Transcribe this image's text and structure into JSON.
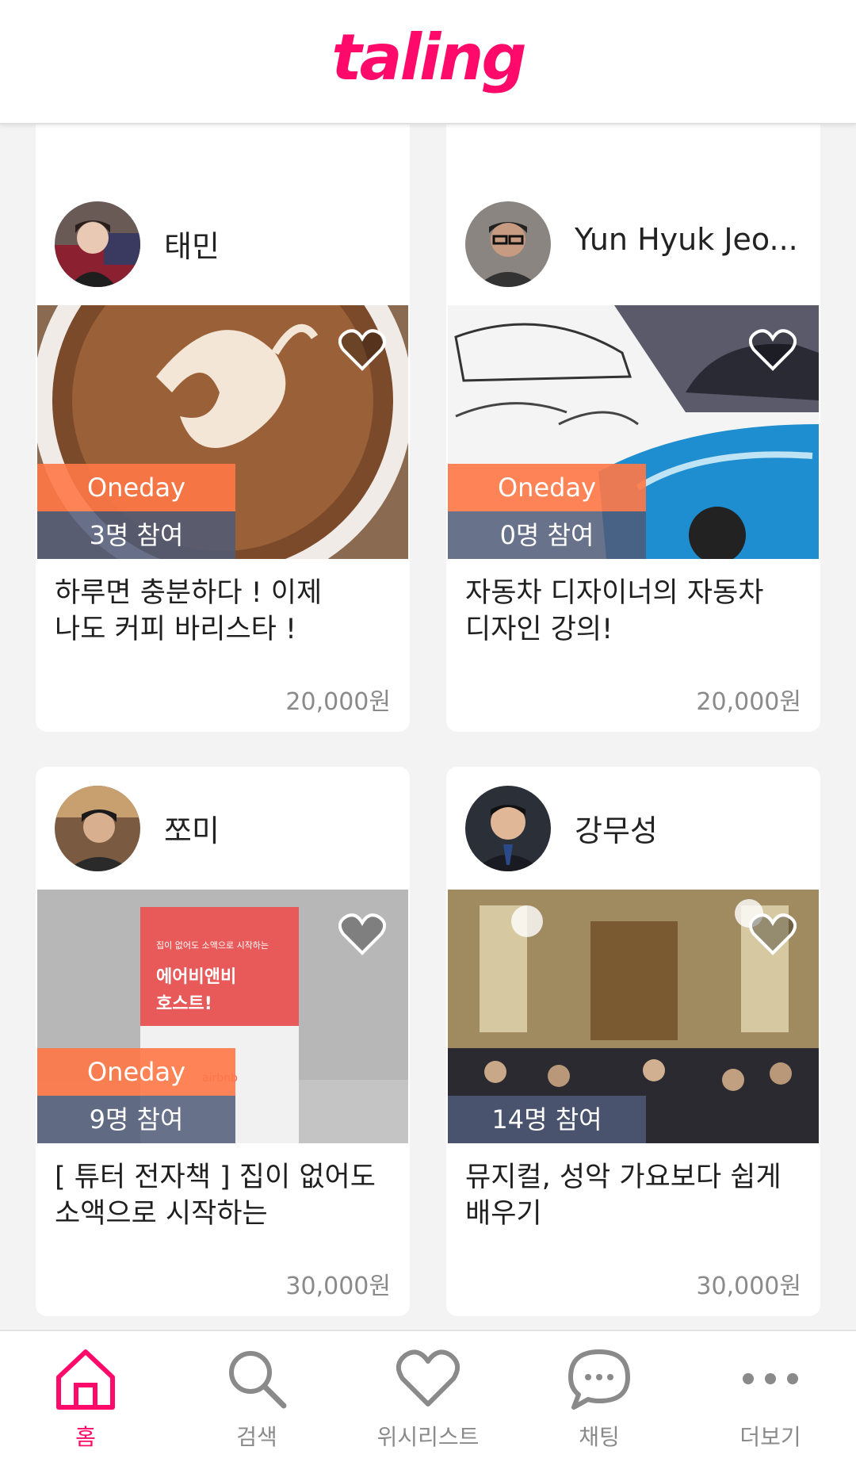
{
  "app": {
    "logo": "taling",
    "accent": "#ff0a6a"
  },
  "cards": [
    {
      "tutor": "태민",
      "title_line1": "하루면 충분하다 ! 이제",
      "title_line2": "나도 커피  바리스타 !",
      "price": "20,000원",
      "oneday": "Oneday",
      "participants": "3명 참여"
    },
    {
      "tutor": "Yun Hyuk Jeo...",
      "title_line1": "자동차 디자이너의 자동차",
      "title_line2": "디자인 강의!",
      "price": "20,000원",
      "oneday": "Oneday",
      "participants": "0명 참여"
    },
    {
      "tutor": "쪼미",
      "title_line1": "[ 튜터 전자책 ] 집이 없어도",
      "title_line2": "소액으로 시작하는",
      "price": "30,000원",
      "oneday": "Oneday",
      "participants": "9명 참여",
      "book_small": "집이 없어도 소액으로 시작하는",
      "book_title_1": "에어비앤비",
      "book_title_2": "호스트!",
      "book_brand": "airbnb"
    },
    {
      "tutor": "강무성",
      "title_line1": "뮤지컬, 성악 가요보다 쉽게",
      "title_line2": "배우기",
      "price": "30,000원",
      "participants": "14명 참여"
    }
  ],
  "nav": [
    {
      "label": "홈",
      "icon": "home-icon",
      "active": true
    },
    {
      "label": "검색",
      "icon": "search-icon"
    },
    {
      "label": "위시리스트",
      "icon": "heart-icon"
    },
    {
      "label": "채팅",
      "icon": "chat-icon"
    },
    {
      "label": "더보기",
      "icon": "more-icon"
    }
  ]
}
